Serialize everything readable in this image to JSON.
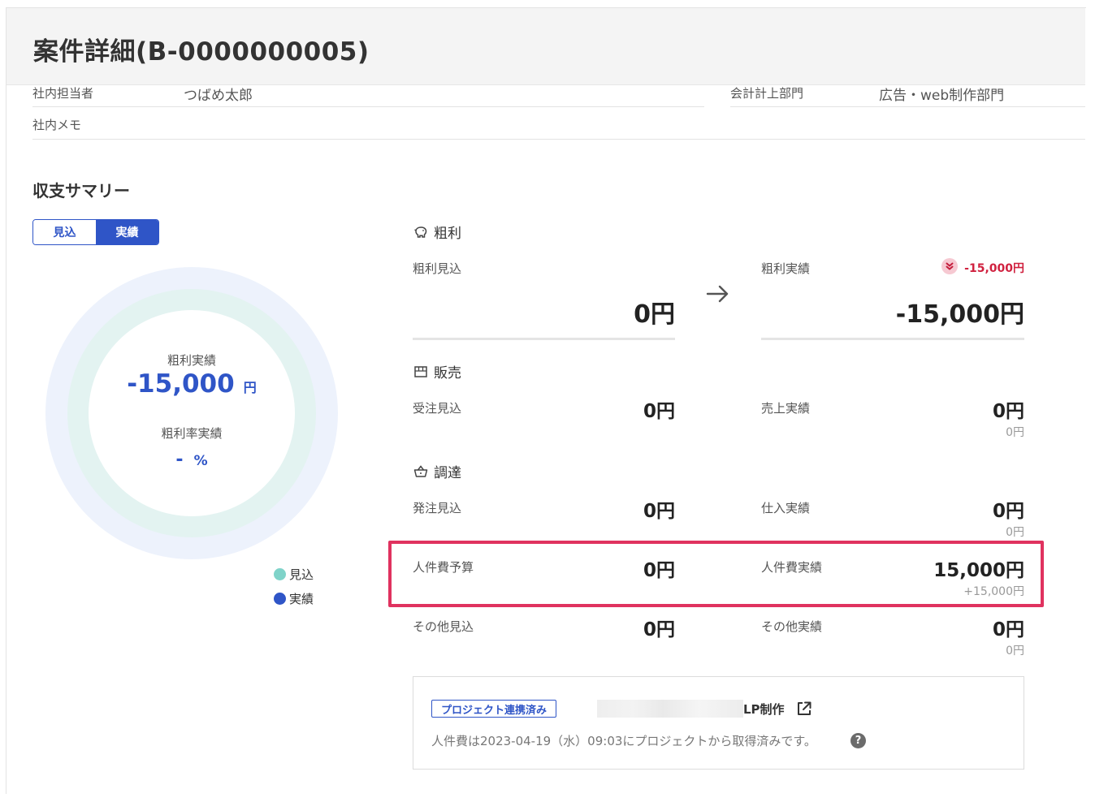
{
  "header": {
    "title": "案件詳細(B-0000000005)"
  },
  "info": {
    "staff_label": "社内担当者",
    "staff_value": "つばめ太郎",
    "dept_label": "会計計上部門",
    "dept_value": "広告・web制作部門",
    "memo_label": "社内メモ"
  },
  "summary": {
    "title": "収支サマリー",
    "toggle": {
      "forecast": "見込",
      "actual": "実績",
      "selected": "実績"
    },
    "donut": {
      "profit_label": "粗利実績",
      "profit_value": "-15,000",
      "profit_unit": "円",
      "rate_label": "粗利率実績",
      "rate_value": "-",
      "rate_unit": "%"
    },
    "legend": [
      {
        "label": "見込",
        "color": "#7fd3c9"
      },
      {
        "label": "実績",
        "color": "#2f55c7"
      }
    ]
  },
  "gross_profit": {
    "title": "粗利",
    "forecast_label": "粗利見込",
    "forecast_value": "0円",
    "actual_label": "粗利実績",
    "actual_value": "-15,000円",
    "diff": "-15,000円"
  },
  "sales": {
    "title": "販売",
    "rows": [
      {
        "f_label": "受注見込",
        "f_value": "0円",
        "a_label": "売上実績",
        "a_value": "0円",
        "a_diff": "0円"
      }
    ]
  },
  "procurement": {
    "title": "調達",
    "rows": [
      {
        "f_label": "発注見込",
        "f_value": "0円",
        "a_label": "仕入実績",
        "a_value": "0円",
        "a_diff": "0円"
      },
      {
        "f_label": "人件費予算",
        "f_value": "0円",
        "a_label": "人件費実績",
        "a_value": "15,000円",
        "a_diff": "+15,000円"
      },
      {
        "f_label": "その他見込",
        "f_value": "0円",
        "a_label": "その他実績",
        "a_value": "0円",
        "a_diff": "0円"
      }
    ]
  },
  "project": {
    "badge": "プロジェクト連携済み",
    "name": "LP制作",
    "note": "人件費は2023-04-19（水）09:03にプロジェクトから取得済みです。",
    "help": "?"
  },
  "colors": {
    "accent": "#2f55c7",
    "negative": "#d0213f",
    "highlight": "#e0325f",
    "ring_outer": "#edf2fc",
    "ring_inner": "#e3f3f1"
  }
}
